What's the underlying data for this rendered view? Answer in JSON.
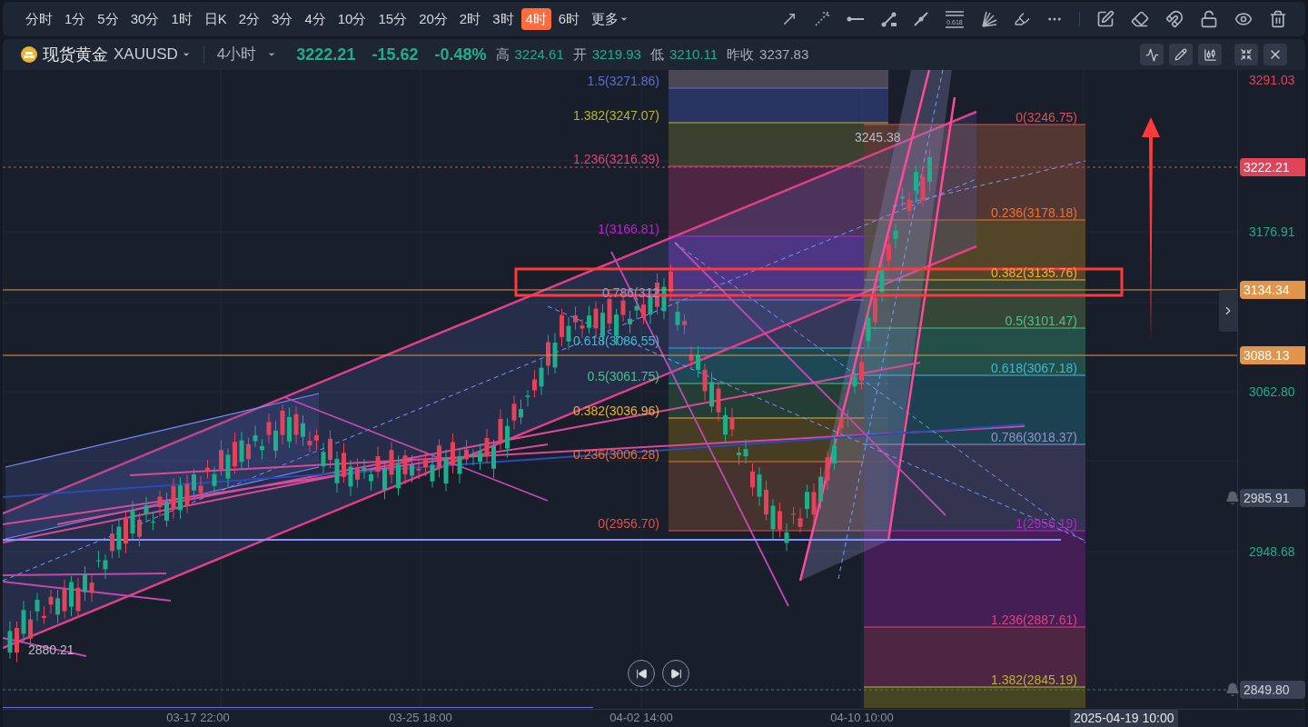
{
  "toolbar": {
    "timeframes": [
      {
        "label": "分时",
        "selected": false
      },
      {
        "label": "1分",
        "selected": false
      },
      {
        "label": "5分",
        "selected": false
      },
      {
        "label": "30分",
        "selected": false
      },
      {
        "label": "1时",
        "selected": false
      },
      {
        "label": "日K",
        "selected": false
      },
      {
        "label": "2分",
        "selected": false
      },
      {
        "label": "3分",
        "selected": false
      },
      {
        "label": "4分",
        "selected": false
      },
      {
        "label": "10分",
        "selected": false
      },
      {
        "label": "15分",
        "selected": false
      },
      {
        "label": "20分",
        "selected": false
      },
      {
        "label": "2时",
        "selected": false
      },
      {
        "label": "3时",
        "selected": false
      },
      {
        "label": "4时",
        "selected": true
      },
      {
        "label": "6时",
        "selected": false
      }
    ],
    "more": "更多",
    "fib_tool_label": "0.618"
  },
  "symbol": {
    "name": "现货黄金",
    "code": "XAUUSD",
    "interval": "4小时",
    "price": "3222.21",
    "change": "-15.62",
    "change_pct": "-0.48%",
    "stats": [
      {
        "label": "高",
        "value": "3224.61",
        "kind": "quote"
      },
      {
        "label": "开",
        "value": "3219.93",
        "kind": "quote"
      },
      {
        "label": "低",
        "value": "3210.11",
        "kind": "quote"
      },
      {
        "label": "昨收",
        "value": "3237.83",
        "kind": "reference"
      }
    ]
  },
  "chart": {
    "fib_left": [
      {
        "label": "1.5(3271.86)",
        "color": "#5b6fd6"
      },
      {
        "label": "1.382(3247.07)",
        "color": "#b5b82a"
      },
      {
        "label": "1.236(3216.39)",
        "color": "#e0457a"
      },
      {
        "label": "1(3166.81)",
        "color": "#c020d0"
      },
      {
        "label": "0.786(312",
        "color": "#9a8fd0"
      },
      {
        "label": "0.618(3086.55)",
        "color": "#3fb8d8"
      },
      {
        "label": "0.5(3061.75)",
        "color": "#4cc38a"
      },
      {
        "label": "0.382(3036.96)",
        "color": "#f0b030"
      },
      {
        "label": "0.236(3006.28)",
        "color": "#f07030"
      },
      {
        "label": "0(2956.70)",
        "color": "#e05050"
      }
    ],
    "fib_right": [
      {
        "label": "0(3246.75)",
        "color": "#e05050"
      },
      {
        "label": "0.236(3178.18)",
        "color": "#f07030"
      },
      {
        "label": "0.382(3135.76)",
        "color": "#f0b030"
      },
      {
        "label": "0.5(3101.47)",
        "color": "#4cc38a"
      },
      {
        "label": "0.618(3067.18)",
        "color": "#3fb8d8"
      },
      {
        "label": "0.786(3018.37)",
        "color": "#9a8fd0"
      },
      {
        "label": "1(2956.19)",
        "color": "#c020d0"
      },
      {
        "label": "1.236(2887.61)",
        "color": "#e0457a"
      },
      {
        "label": "1.382(2845.19)",
        "color": "#b5b82a"
      }
    ],
    "price_notes": [
      "3245.38",
      "2880.21"
    ],
    "price_axis": [
      {
        "text": "3291.03",
        "kind": "tick",
        "color": "#e0435a"
      },
      {
        "text": "3222.21",
        "kind": "badge",
        "color": "#e0435a"
      },
      {
        "text": "3176.91",
        "kind": "tick",
        "color": "#1fae8a"
      },
      {
        "text": "3134.34",
        "kind": "badge",
        "color": "#e0954a"
      },
      {
        "text": "3088.13",
        "kind": "badge",
        "color": "#e0954a"
      },
      {
        "text": "3062.80",
        "kind": "tick",
        "color": "#1fae8a"
      },
      {
        "text": "2985.91",
        "kind": "alert",
        "color": "#3a4256"
      },
      {
        "text": "2948.68",
        "kind": "tick",
        "color": "#1fae8a"
      },
      {
        "text": "2849.80",
        "kind": "alert",
        "color": "#3a4256"
      }
    ],
    "time_axis": [
      "03-17 22:00",
      "03-25 18:00",
      "04-02 14:00",
      "04-10 10:00"
    ],
    "cursor_time": "2025-04-19 10:00"
  }
}
